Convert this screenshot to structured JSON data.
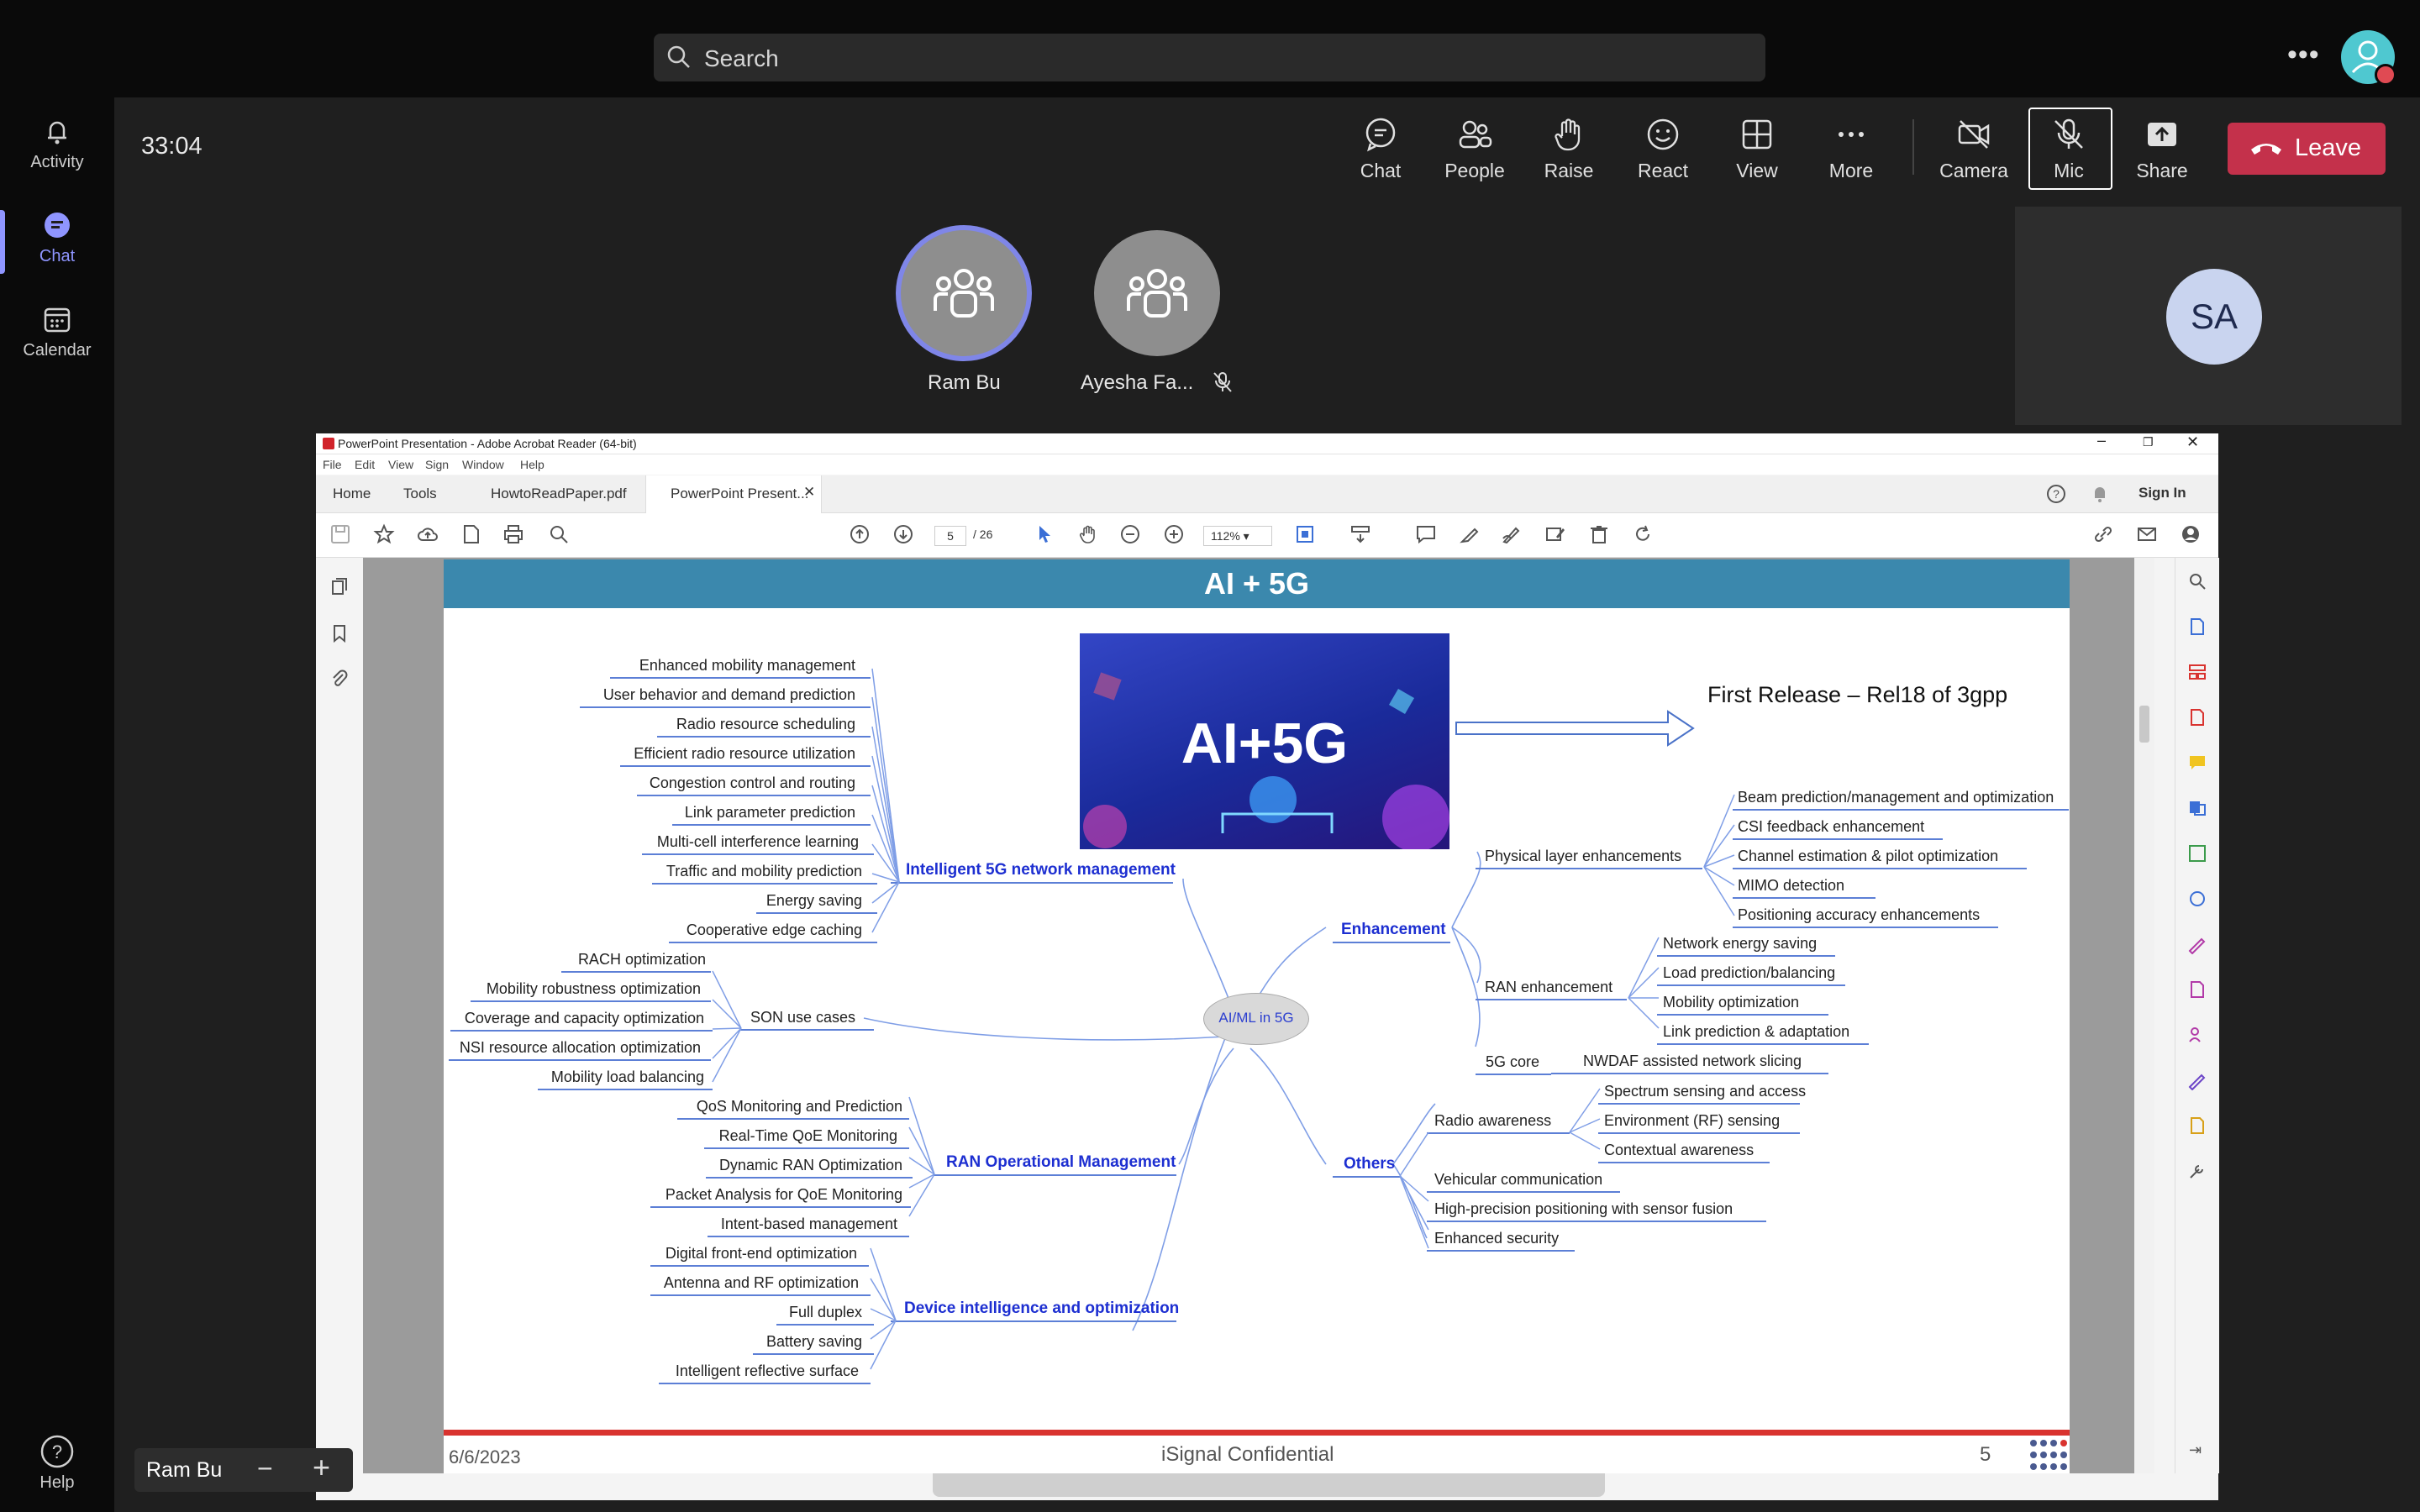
{
  "search": {
    "placeholder": "Search"
  },
  "rail": {
    "activity": "Activity",
    "chat": "Chat",
    "calendar": "Calendar",
    "help": "Help"
  },
  "meeting": {
    "timer": "33:04",
    "toolbar": {
      "chat": "Chat",
      "people": "People",
      "raise": "Raise",
      "react": "React",
      "view": "View",
      "more": "More",
      "camera": "Camera",
      "mic": "Mic",
      "share": "Share",
      "leave": "Leave"
    },
    "participants": [
      {
        "name": "Ram Bu"
      },
      {
        "name": "Ayesha Fa..."
      }
    ],
    "self_initials": "SA",
    "zoom_label": "Ram Bu"
  },
  "acrobat": {
    "window_title": "PowerPoint Presentation - Adobe Acrobat Reader (64-bit)",
    "menu": [
      "File",
      "Edit",
      "View",
      "Sign",
      "Window",
      "Help"
    ],
    "tabs": [
      "Home",
      "Tools",
      "HowtoReadPaper.pdf",
      "PowerPoint Present..."
    ],
    "sign_in": "Sign In",
    "page_current": "5",
    "page_total": "/ 26",
    "zoom": "112%"
  },
  "slide": {
    "title": "AI + 5G",
    "hero_text": "AI+5G",
    "first_release": "First Release – Rel18 of 3gpp",
    "center": "AI/ML in 5G",
    "footer_date": "6/6/2023",
    "footer_conf": "iSignal Confidential",
    "footer_page": "5",
    "branches": {
      "intelligent": {
        "title": "Intelligent 5G network management",
        "items": [
          "Enhanced mobility management",
          "User behavior and demand prediction",
          "Radio resource scheduling",
          "Efficient radio resource utilization",
          "Congestion control and routing",
          "Link parameter prediction",
          "Multi-cell interference learning",
          "Traffic and mobility prediction",
          "Energy saving",
          "Cooperative edge caching"
        ]
      },
      "son": {
        "title": "SON use cases",
        "items": [
          "RACH optimization",
          "Mobility robustness optimization",
          "Coverage and capacity optimization",
          "NSI resource allocation optimization",
          "Mobility load balancing"
        ]
      },
      "ran_ops": {
        "title": "RAN Operational Management",
        "items": [
          "QoS Monitoring and Prediction",
          "Real-Time QoE Monitoring",
          "Dynamic RAN Optimization",
          "Packet Analysis for QoE Monitoring",
          "Intent-based management"
        ]
      },
      "device": {
        "title": "Device intelligence and optimization",
        "items": [
          "Digital front-end optimization",
          "Antenna and RF optimization",
          "Full duplex",
          "Battery saving",
          "Intelligent reflective surface"
        ]
      },
      "enhancement": {
        "title": "Enhancement",
        "physical": "Physical layer enhancements",
        "physical_items": [
          "Beam prediction/management and optimization",
          "CSI feedback enhancement",
          "Channel estimation & pilot optimization",
          "MIMO detection",
          "Positioning accuracy enhancements"
        ],
        "ran": "RAN enhancement",
        "ran_items": [
          "Network energy saving",
          "Load prediction/balancing",
          "Mobility optimization",
          "Link prediction & adaptation"
        ],
        "core": "5G core",
        "core_items": [
          "NWDAF assisted network slicing"
        ]
      },
      "others": {
        "title": "Others",
        "radio": "Radio awareness",
        "radio_items": [
          "Spectrum sensing and access",
          "Environment (RF) sensing",
          "Contextual awareness"
        ],
        "items": [
          "Vehicular communication",
          "High-precision positioning with sensor fusion",
          "Enhanced security"
        ]
      }
    }
  },
  "colors": {
    "leave": "#c4314b",
    "accent": "#8f95ff",
    "slide_header": "#3b88ad",
    "branch_title": "#1d2fd1"
  }
}
